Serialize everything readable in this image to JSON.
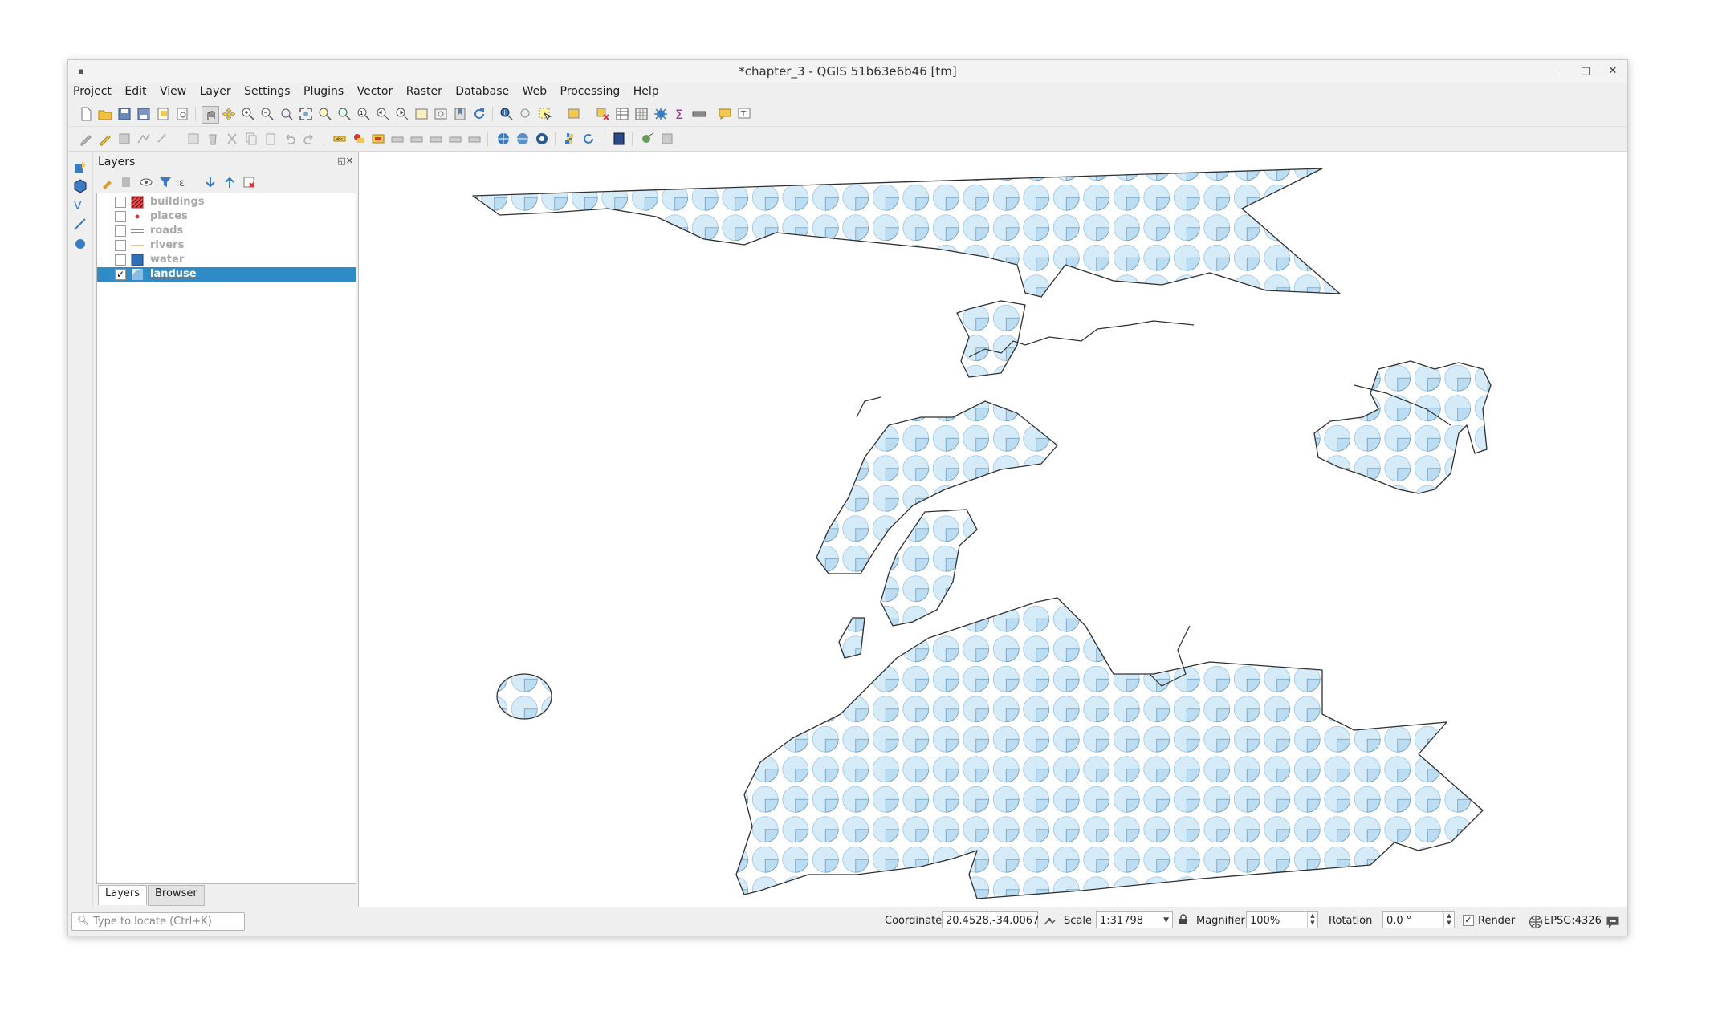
{
  "window": {
    "title": "*chapter_3 - QGIS 51b63e6b46 [tm]",
    "min_glyph": "–",
    "max_glyph": "□",
    "close_glyph": "✕"
  },
  "menu": [
    {
      "label": "Project"
    },
    {
      "label": "Edit"
    },
    {
      "label": "View"
    },
    {
      "label": "Layer"
    },
    {
      "label": "Settings"
    },
    {
      "label": "Plugins"
    },
    {
      "label": "Vector"
    },
    {
      "label": "Raster"
    },
    {
      "label": "Database"
    },
    {
      "label": "Web"
    },
    {
      "label": "Processing"
    },
    {
      "label": "Help"
    }
  ],
  "layers_panel": {
    "title": "Layers",
    "controls": "◱✕",
    "layers": [
      {
        "name": "buildings",
        "checked": false,
        "symbol": "hatched-polygon"
      },
      {
        "name": "places",
        "checked": false,
        "symbol": "point"
      },
      {
        "name": "roads",
        "checked": false,
        "symbol": "line"
      },
      {
        "name": "rivers",
        "checked": false,
        "symbol": "line"
      },
      {
        "name": "water",
        "checked": false,
        "symbol": "polygon"
      },
      {
        "name": "landuse",
        "checked": true,
        "symbol": "pattern-polygon",
        "selected": true
      }
    ],
    "tabs": [
      {
        "label": "Layers",
        "active": true
      },
      {
        "label": "Browser",
        "active": false
      }
    ]
  },
  "statusbar": {
    "locate_placeholder": "Type to locate (Ctrl+K)",
    "coordinate_label": "Coordinate",
    "coordinate_value": "20.4528,-34.0067",
    "scale_label": "Scale",
    "scale_value": "1:31798",
    "magnifier_label": "Magnifier",
    "magnifier_value": "100%",
    "rotation_label": "Rotation",
    "rotation_value": "0.0 °",
    "render_label": "Render",
    "render_checked": true,
    "crs_label": "EPSG:4326"
  },
  "colors": {
    "selection": "#308cc6",
    "fill": "#d6ebf8",
    "stroke": "#333333"
  }
}
